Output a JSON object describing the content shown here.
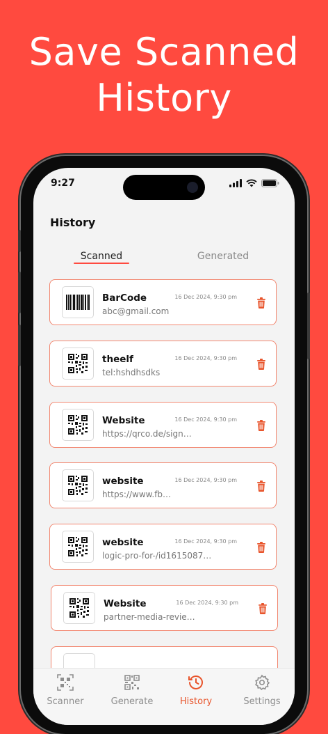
{
  "promo": {
    "headline_line1": "Save Scanned",
    "headline_line2": "History"
  },
  "status_bar": {
    "time": "9:27"
  },
  "page": {
    "title": "History"
  },
  "tabs": [
    {
      "label": "Scanned",
      "active": true
    },
    {
      "label": "Generated",
      "active": false
    }
  ],
  "history": [
    {
      "kind": "barcode",
      "title": "BarCode",
      "subtitle": "abc@gmail.com",
      "date": "16 Dec 2024, 9:30 pm"
    },
    {
      "kind": "qr",
      "title": "theelf",
      "subtitle": "tel:hshdhsdks",
      "date": "16 Dec 2024, 9:30 pm"
    },
    {
      "kind": "qr",
      "title": "Website",
      "subtitle": "https://qrco.de/sign…",
      "date": "16 Dec 2024, 9:30 pm"
    },
    {
      "kind": "qr",
      "title": "website",
      "subtitle": "https://www.fb…",
      "date": "16 Dec 2024, 9:30 pm"
    },
    {
      "kind": "qr",
      "title": "website",
      "subtitle": "logic-pro-for-/id1615087…",
      "date": "16 Dec 2024, 9:30 pm"
    },
    {
      "kind": "qr",
      "title": "Website",
      "subtitle": "partner-media-revie…",
      "date": "16 Dec 2024, 9:30 pm"
    }
  ],
  "bottom_nav": [
    {
      "label": "Scanner",
      "icon": "scanner-qr-icon",
      "active": false
    },
    {
      "label": "Generate",
      "icon": "generate-qr-icon",
      "active": false
    },
    {
      "label": "History",
      "icon": "history-clock-icon",
      "active": true
    },
    {
      "label": "Settings",
      "icon": "gear-icon",
      "active": false
    }
  ],
  "colors": {
    "background": "#FF4A3F",
    "accent": "#E8542B",
    "card_border": "#F2866F"
  }
}
